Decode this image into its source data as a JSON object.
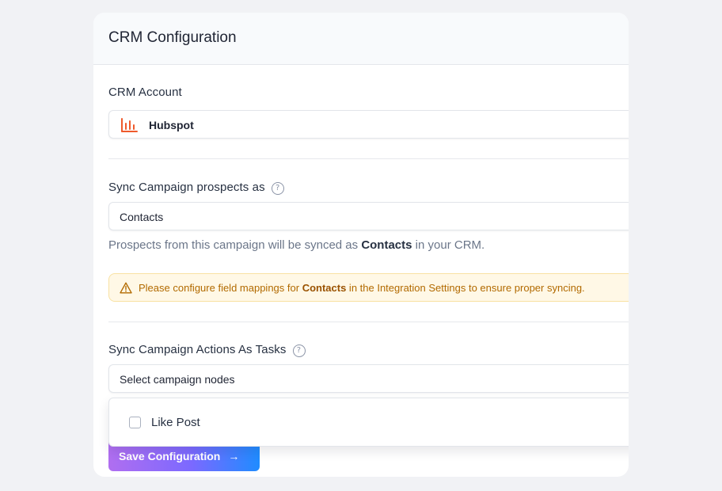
{
  "card": {
    "title": "CRM Configuration"
  },
  "crm_account": {
    "label": "CRM Account",
    "selected": "Hubspot",
    "icon": "hubspot-chart-icon",
    "icon_color": "#ef5a2c"
  },
  "sync_prospects": {
    "label": "Sync Campaign prospects as",
    "help_icon": "question-circle-icon",
    "help_glyph": "?",
    "selected": "Contacts",
    "helper_prefix": "Prospects from this campaign will be synced as ",
    "helper_bold": "Contacts",
    "helper_suffix": " in your CRM."
  },
  "warning": {
    "icon": "warning-triangle-icon",
    "prefix": "Please configure field mappings for ",
    "bold": "Contacts",
    "suffix": " in the Integration Settings to ensure proper syncing.",
    "bg_color": "#fff8e6",
    "text_color": "#b26a00"
  },
  "sync_actions": {
    "label": "Sync Campaign Actions As Tasks",
    "help_icon": "question-circle-icon",
    "help_glyph": "?",
    "placeholder": "Select campaign nodes",
    "options": [
      {
        "label": "Like Post",
        "checked": false
      }
    ]
  },
  "save_button": {
    "label": "Save Configuration",
    "arrow": "→",
    "icon": "arrow-right-icon"
  }
}
